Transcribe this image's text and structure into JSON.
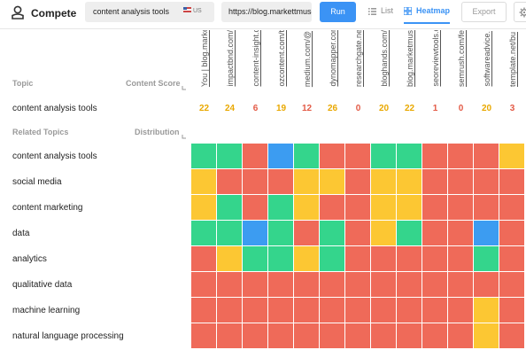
{
  "toolbar": {
    "app_title": "Compete",
    "topic_value": "content analysis tools",
    "country": "US",
    "url_value": "https://blog.markettmuse.com/",
    "run_label": "Run",
    "tab_list": "List",
    "tab_heatmap": "Heatmap",
    "active_tab": "Heatmap",
    "export_label": "Export",
    "accent_color": "#3b93f5"
  },
  "domains": [
    "You | blog.marke",
    "impactbnd.com/",
    "content-insight.c",
    "ozcontent.com/t",
    "medium.com/@",
    "dynomapper.cor",
    "researchgate.ne",
    "bloghands.com/",
    "blog.marketmus",
    "seoreviewtools.c",
    "semrush.com/fe",
    "softwareadvice.",
    "template.net/bu"
  ],
  "topic_section": {
    "topic_header": "Topic",
    "score_header": "Content Score",
    "topic": "content analysis tools",
    "scores": [
      "22",
      "24",
      "6",
      "19",
      "12",
      "26",
      "0",
      "20",
      "22",
      "1",
      "0",
      "20",
      "3"
    ],
    "score_levels": [
      "m",
      "m",
      "l",
      "m",
      "l",
      "m",
      "l",
      "m",
      "m",
      "l",
      "l",
      "m",
      "l"
    ]
  },
  "related_section": {
    "topics_header": "Related Topics",
    "distribution_header": "Distribution",
    "rows": [
      {
        "label": "content analysis tools",
        "cells": [
          "h",
          "h",
          "l",
          "b",
          "h",
          "l",
          "l",
          "h",
          "h",
          "l",
          "l",
          "l",
          "m"
        ]
      },
      {
        "label": "social media",
        "cells": [
          "m",
          "l",
          "l",
          "l",
          "m",
          "m",
          "l",
          "m",
          "m",
          "l",
          "l",
          "l",
          "l"
        ]
      },
      {
        "label": "content marketing",
        "cells": [
          "m",
          "h",
          "l",
          "h",
          "m",
          "l",
          "l",
          "m",
          "m",
          "l",
          "l",
          "l",
          "l"
        ]
      },
      {
        "label": "data",
        "cells": [
          "h",
          "h",
          "b",
          "h",
          "l",
          "h",
          "l",
          "m",
          "h",
          "l",
          "l",
          "b",
          "l"
        ]
      },
      {
        "label": "analytics",
        "cells": [
          "l",
          "m",
          "h",
          "h",
          "m",
          "h",
          "l",
          "l",
          "l",
          "l",
          "l",
          "h",
          "l"
        ]
      },
      {
        "label": "qualitative data",
        "cells": [
          "l",
          "l",
          "l",
          "l",
          "l",
          "l",
          "l",
          "l",
          "l",
          "l",
          "l",
          "l",
          "l"
        ]
      },
      {
        "label": "machine learning",
        "cells": [
          "l",
          "l",
          "l",
          "l",
          "l",
          "l",
          "l",
          "l",
          "l",
          "l",
          "l",
          "m",
          "l"
        ]
      },
      {
        "label": "natural language processing",
        "cells": [
          "l",
          "l",
          "l",
          "l",
          "l",
          "l",
          "l",
          "l",
          "l",
          "l",
          "l",
          "m",
          "l"
        ]
      }
    ]
  },
  "legend_colors": {
    "high": "#34d58c",
    "medium": "#fcc733",
    "low": "#ef6a59",
    "target": "#3c9cf1"
  },
  "score_colors": {
    "m": "#e9a800",
    "l": "#e35a46"
  }
}
